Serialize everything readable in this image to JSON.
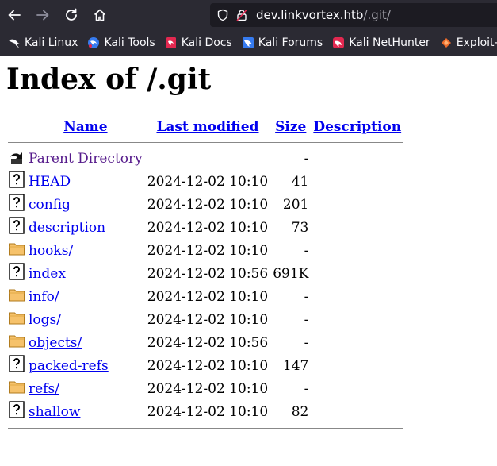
{
  "browser": {
    "url_host": "dev.linkvortex.htb",
    "url_path": "/.git/"
  },
  "bookmarks": [
    {
      "label": "Kali Linux",
      "icon": "kali-dragon-icon"
    },
    {
      "label": "Kali Tools",
      "icon": "kali-tools-icon"
    },
    {
      "label": "Kali Docs",
      "icon": "kali-docs-icon"
    },
    {
      "label": "Kali Forums",
      "icon": "kali-forums-icon"
    },
    {
      "label": "Kali NetHunter",
      "icon": "kali-nethunter-icon"
    },
    {
      "label": "Exploit-DB",
      "icon": "exploit-db-icon"
    }
  ],
  "page": {
    "title": "Index of /.git",
    "headers": {
      "name": "Name",
      "modified": "Last modified",
      "size": "Size",
      "description": "Description"
    },
    "rows": [
      {
        "name": "Parent Directory",
        "modified": "",
        "size": "-",
        "type": "back"
      },
      {
        "name": "HEAD",
        "modified": "2024-12-02 10:10",
        "size": "41",
        "type": "file"
      },
      {
        "name": "config",
        "modified": "2024-12-02 10:10",
        "size": "201",
        "type": "file"
      },
      {
        "name": "description",
        "modified": "2024-12-02 10:10",
        "size": "73",
        "type": "file"
      },
      {
        "name": "hooks/",
        "modified": "2024-12-02 10:10",
        "size": "-",
        "type": "folder"
      },
      {
        "name": "index",
        "modified": "2024-12-02 10:56",
        "size": "691K",
        "type": "file"
      },
      {
        "name": "info/",
        "modified": "2024-12-02 10:10",
        "size": "-",
        "type": "folder"
      },
      {
        "name": "logs/",
        "modified": "2024-12-02 10:10",
        "size": "-",
        "type": "folder"
      },
      {
        "name": "objects/",
        "modified": "2024-12-02 10:56",
        "size": "-",
        "type": "folder"
      },
      {
        "name": "packed-refs",
        "modified": "2024-12-02 10:10",
        "size": "147",
        "type": "file"
      },
      {
        "name": "refs/",
        "modified": "2024-12-02 10:10",
        "size": "-",
        "type": "folder"
      },
      {
        "name": "shallow",
        "modified": "2024-12-02 10:10",
        "size": "82",
        "type": "file"
      }
    ]
  }
}
